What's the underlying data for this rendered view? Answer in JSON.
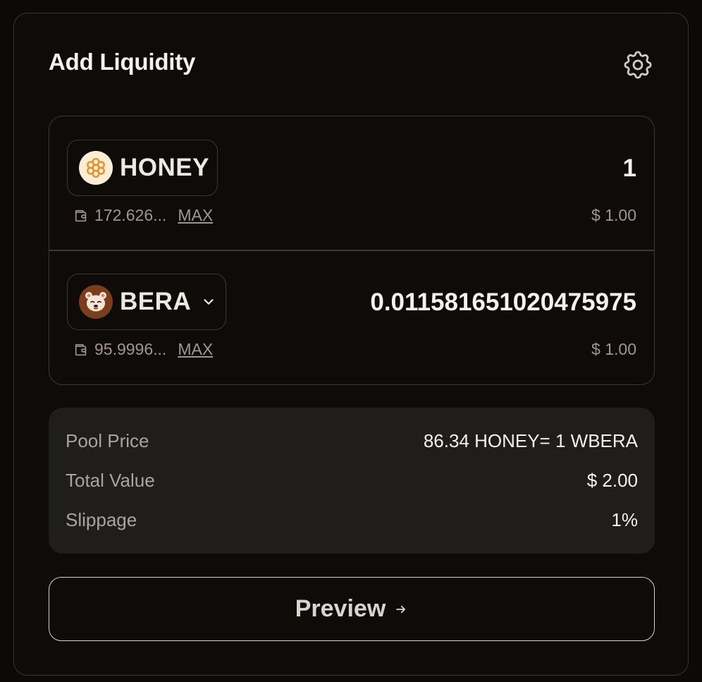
{
  "header": {
    "title": "Add Liquidity",
    "settings_icon": "gear-icon"
  },
  "tokens": [
    {
      "symbol": "HONEY",
      "icon": "honeycomb-icon",
      "amount": "1",
      "balance": "172.626...",
      "max_label": "MAX",
      "usd_value": "$ 1.00",
      "has_dropdown": false
    },
    {
      "symbol": "BERA",
      "icon": "bear-icon",
      "amount": "0.011581651020475975",
      "balance": "95.9996...",
      "max_label": "MAX",
      "usd_value": "$ 1.00",
      "has_dropdown": true
    }
  ],
  "info": {
    "pool_price_label": "Pool Price",
    "pool_price_value": "86.34 HONEY= 1 WBERA",
    "total_value_label": "Total Value",
    "total_value_value": "$ 2.00",
    "slippage_label": "Slippage",
    "slippage_value": "1%"
  },
  "preview_button": {
    "label": "Preview",
    "icon": "arrow-right-icon"
  },
  "colors": {
    "background": "#0c0908",
    "card": "#0f0b09",
    "border": "#3d3836",
    "info_bg": "#1f1e1d",
    "honey_logo_bg": "#fbeed2",
    "honey_accent": "#e8912c",
    "bera_logo_bg": "#7a3e1c"
  }
}
